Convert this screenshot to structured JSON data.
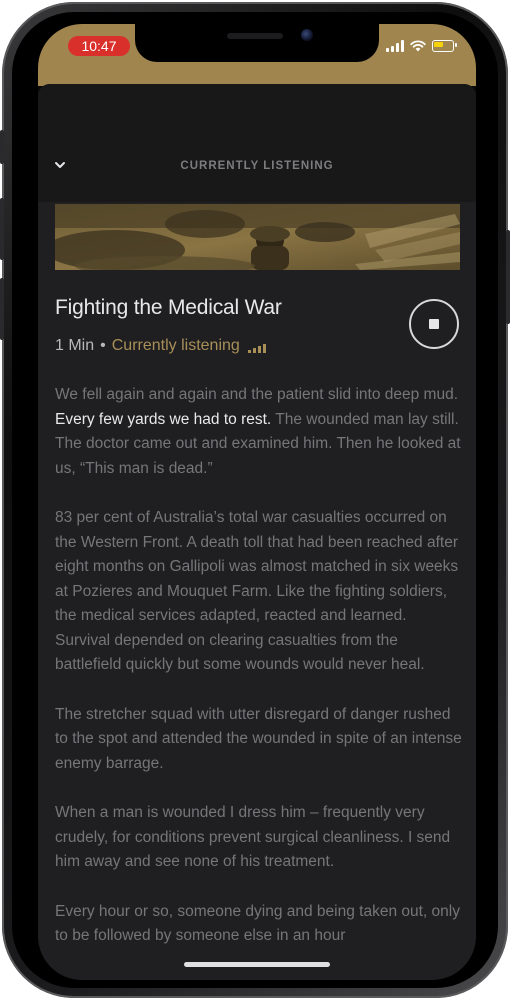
{
  "status_bar": {
    "time": "10:47",
    "background_color": "#a0854e",
    "time_pill_color": "#d9302b",
    "icons": [
      "cellular-signal-icon",
      "wifi-icon",
      "battery-icon"
    ],
    "battery_color": "#f5d20a"
  },
  "header": {
    "title": "CURRENTLY LISTENING",
    "collapse_icon": "chevron-down-icon"
  },
  "story": {
    "title": "Fighting the Medical War",
    "duration": "1 Min",
    "separator": "•",
    "status": "Currently listening",
    "status_icon": "equalizer-icon",
    "accent_color": "#a88f58",
    "control_icon": "stop-icon"
  },
  "transcript": {
    "paragraphs": [
      {
        "before": "We fell again and again and the patient slid into deep mud. ",
        "highlight": "Every few yards we had to rest.",
        "after": " The wounded man lay still. The doctor came out and examined him. Then he looked at us, “This man is dead.”"
      },
      {
        "text": "83 per cent of Australia’s total war casualties occurred on the Western Front. A death toll that had been reached after eight months on Gallipoli was almost matched in six weeks at Pozieres and Mouquet Farm. Like the fighting soldiers, the medical services adapted, reacted and learned. Survival depended on clearing casualties from the battlefield quickly but some wounds would never heal."
      },
      {
        "text": "The stretcher squad with utter disregard of danger rushed to the spot and attended the wounded in spite of an intense enemy barrage."
      },
      {
        "text": "When a man is wounded I dress him – frequently very crudely, for conditions prevent surgical cleanliness. I send him away and see none of his treatment."
      },
      {
        "text": "Every hour or so, someone dying and being taken out, only to be followed by someone else in an hour"
      }
    ]
  }
}
